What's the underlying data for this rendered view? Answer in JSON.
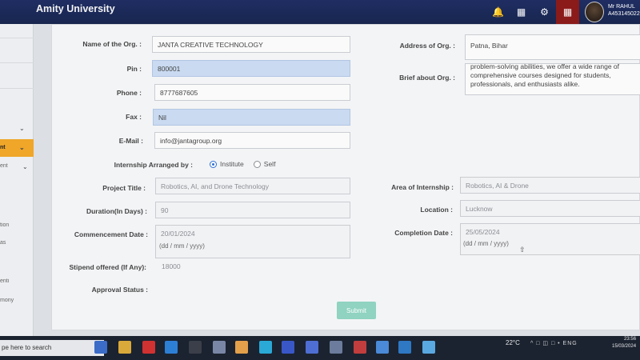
{
  "header": {
    "brand": "Amity University",
    "user_name": "Mr RAHUL",
    "user_id": "A453145022",
    "icons": [
      "bell-icon",
      "book-icon",
      "settings-icon",
      "calendar-icon"
    ]
  },
  "sidebar": {
    "items": [
      {
        "label": "nt",
        "active": true
      },
      {
        "label": "ent",
        "active": false
      },
      {
        "label": "tion",
        "active": false
      },
      {
        "label": "as",
        "active": false
      },
      {
        "label": "enti",
        "active": false
      },
      {
        "label": "mony",
        "active": false
      }
    ]
  },
  "form": {
    "org_name": {
      "label": "Name of the Org. :",
      "value": "JANTA CREATIVE TECHNOLOGY"
    },
    "pin": {
      "label": "Pin :",
      "value": "800001"
    },
    "phone": {
      "label": "Phone :",
      "value": "8777687605"
    },
    "fax": {
      "label": "Fax :",
      "value": "Nil"
    },
    "email": {
      "label": "E-Mail :",
      "value": "info@jantagroup.org"
    },
    "internship_arranged": {
      "label": "Internship Arranged by :",
      "options": [
        "Institute",
        "Self"
      ],
      "selected": "Institute"
    },
    "project_title": {
      "label": "Project Title :",
      "value": "Robotics, AI, and Drone Technology"
    },
    "duration": {
      "label": "Duration(In Days) :",
      "value": "90"
    },
    "commencement_date": {
      "label": "Commencement Date :",
      "value": "20/01/2024",
      "hint": "(dd / mm / yyyy)"
    },
    "stipend": {
      "label": "Stipend offered (If Any):",
      "value": "18000"
    },
    "approval_status": {
      "label": "Approval Status :",
      "value": ""
    },
    "address": {
      "label": "Address of Org. :",
      "value": "Patna, Bihar"
    },
    "brief": {
      "label": "Brief about Org. :",
      "value": "problem-solving abilities, we offer a wide range of comprehensive courses designed for students, professionals, and enthusiasts alike."
    },
    "area": {
      "label": "Area of Internship :",
      "value": "Robotics, AI & Drone"
    },
    "location": {
      "label": "Location :",
      "value": "Lucknow"
    },
    "completion_date": {
      "label": "Completion Date :",
      "value": "25/05/2024",
      "hint": "(dd / mm / yyyy)"
    },
    "submit_label": "Submit"
  },
  "taskbar": {
    "search_placeholder": "pe here to search",
    "temperature": "22°C",
    "language": "ENG",
    "time": "23:56",
    "date": "15/03/2024"
  }
}
